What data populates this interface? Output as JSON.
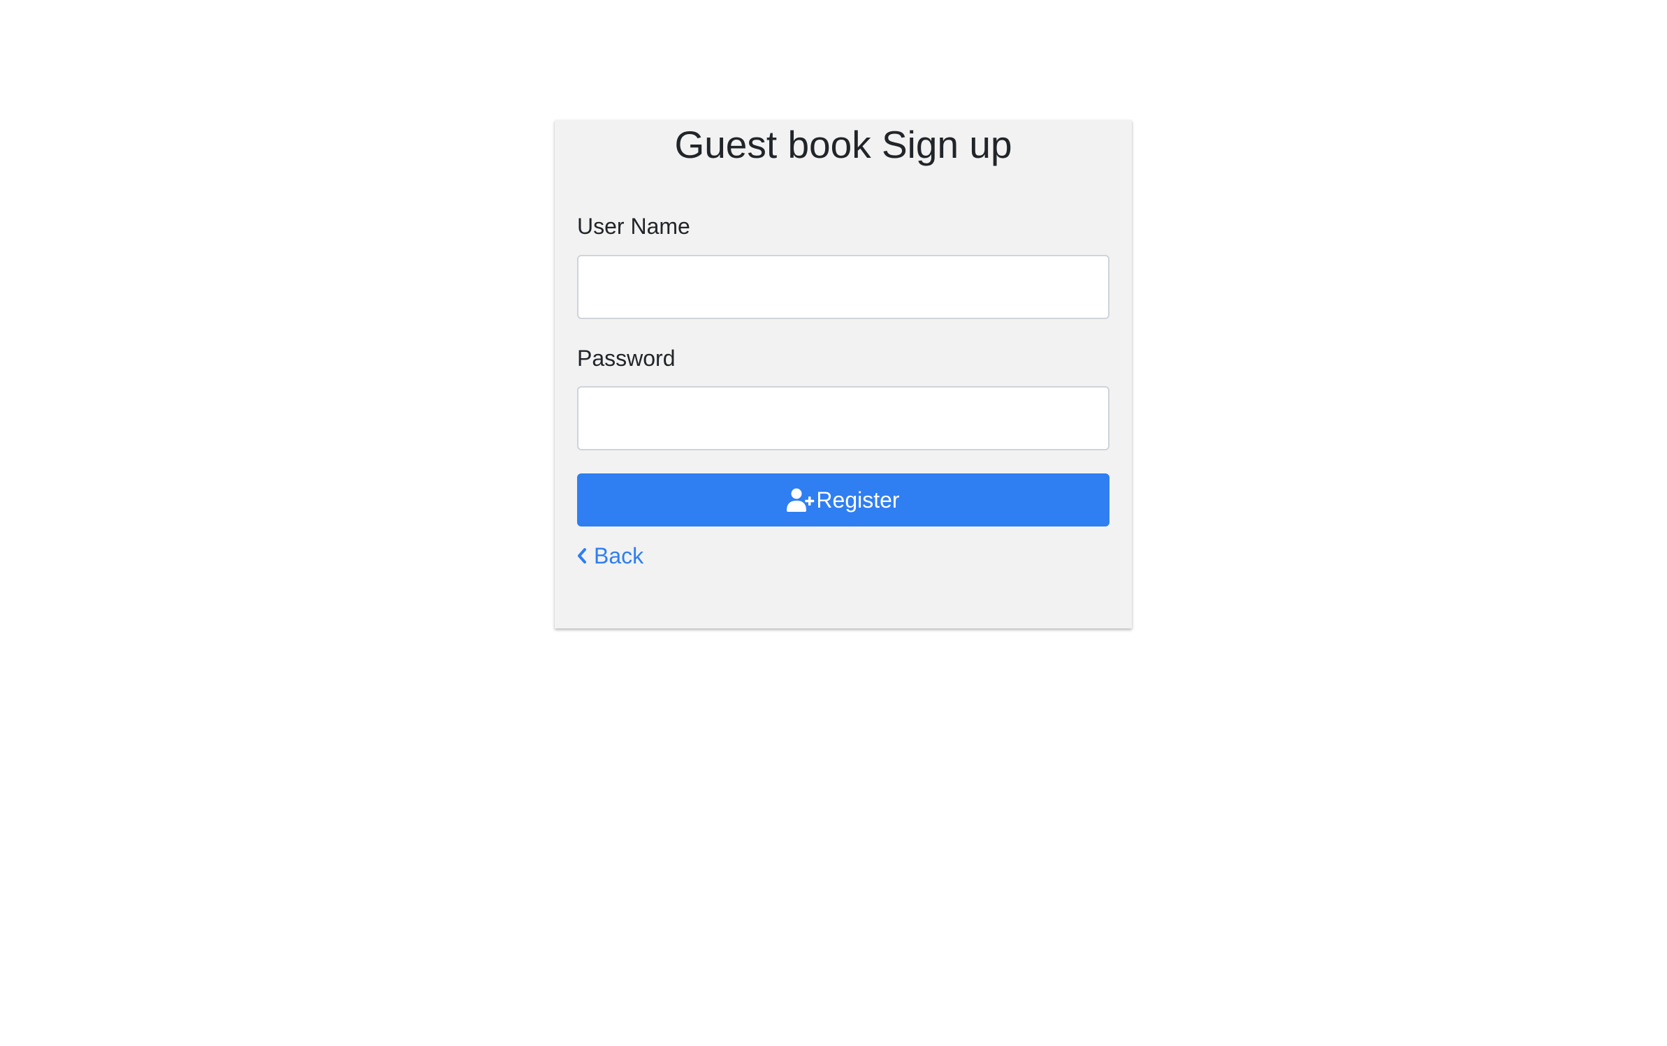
{
  "page": {
    "title": "Guest book Sign up"
  },
  "form": {
    "username_label": "User Name",
    "username_value": "",
    "password_label": "Password",
    "password_value": "",
    "register_label": "Register",
    "register_icon": "user-plus-icon",
    "back_label": "Back",
    "back_icon": "chevron-left-icon"
  },
  "colors": {
    "card_background": "#f2f2f2",
    "primary": "#2f7ef2",
    "link": "#2f7ef2",
    "text": "#212529"
  }
}
